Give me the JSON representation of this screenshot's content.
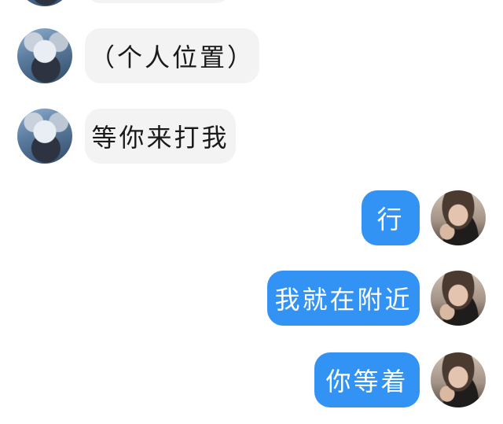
{
  "conversation": {
    "messages": [
      {
        "direction": "incoming",
        "text": "（个人位置）"
      },
      {
        "direction": "incoming",
        "text": "等你来打我"
      },
      {
        "direction": "outgoing",
        "text": "行"
      },
      {
        "direction": "outgoing",
        "text": "我就在附近"
      },
      {
        "direction": "outgoing",
        "text": "你等着"
      }
    ]
  },
  "colors": {
    "incoming_bubble": "#f3f3f3",
    "outgoing_bubble": "#3393f5",
    "incoming_text": "#1a1a1a",
    "outgoing_text": "#ffffff",
    "background": "#ffffff"
  }
}
